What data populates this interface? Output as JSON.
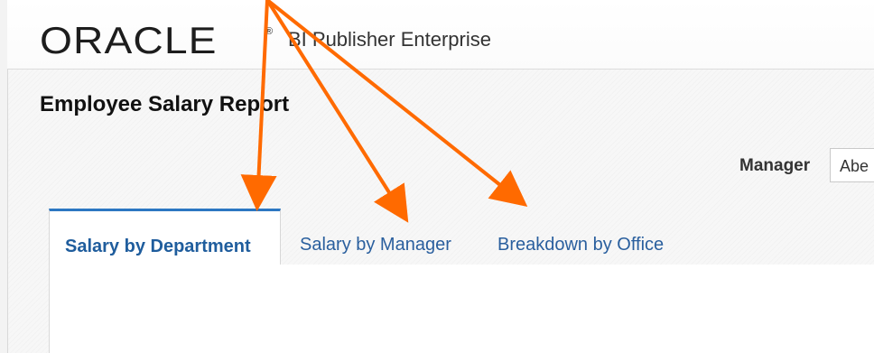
{
  "header": {
    "logo_text": "ORACLE",
    "logo_mark": "®",
    "product_name": "BI Publisher Enterprise"
  },
  "report": {
    "title": "Employee Salary Report"
  },
  "filters": {
    "manager_label": "Manager",
    "manager_value": "Abe"
  },
  "tabs": [
    {
      "label": "Salary by Department",
      "active": true
    },
    {
      "label": "Salary by Manager",
      "active": false
    },
    {
      "label": "Breakdown by Office",
      "active": false
    }
  ],
  "annotations": {
    "arrow_color": "#ff6a00",
    "arrow_count": 3
  },
  "colors": {
    "active_tab_accent": "#2c77c2",
    "tab_text": "#2a5f9e"
  }
}
